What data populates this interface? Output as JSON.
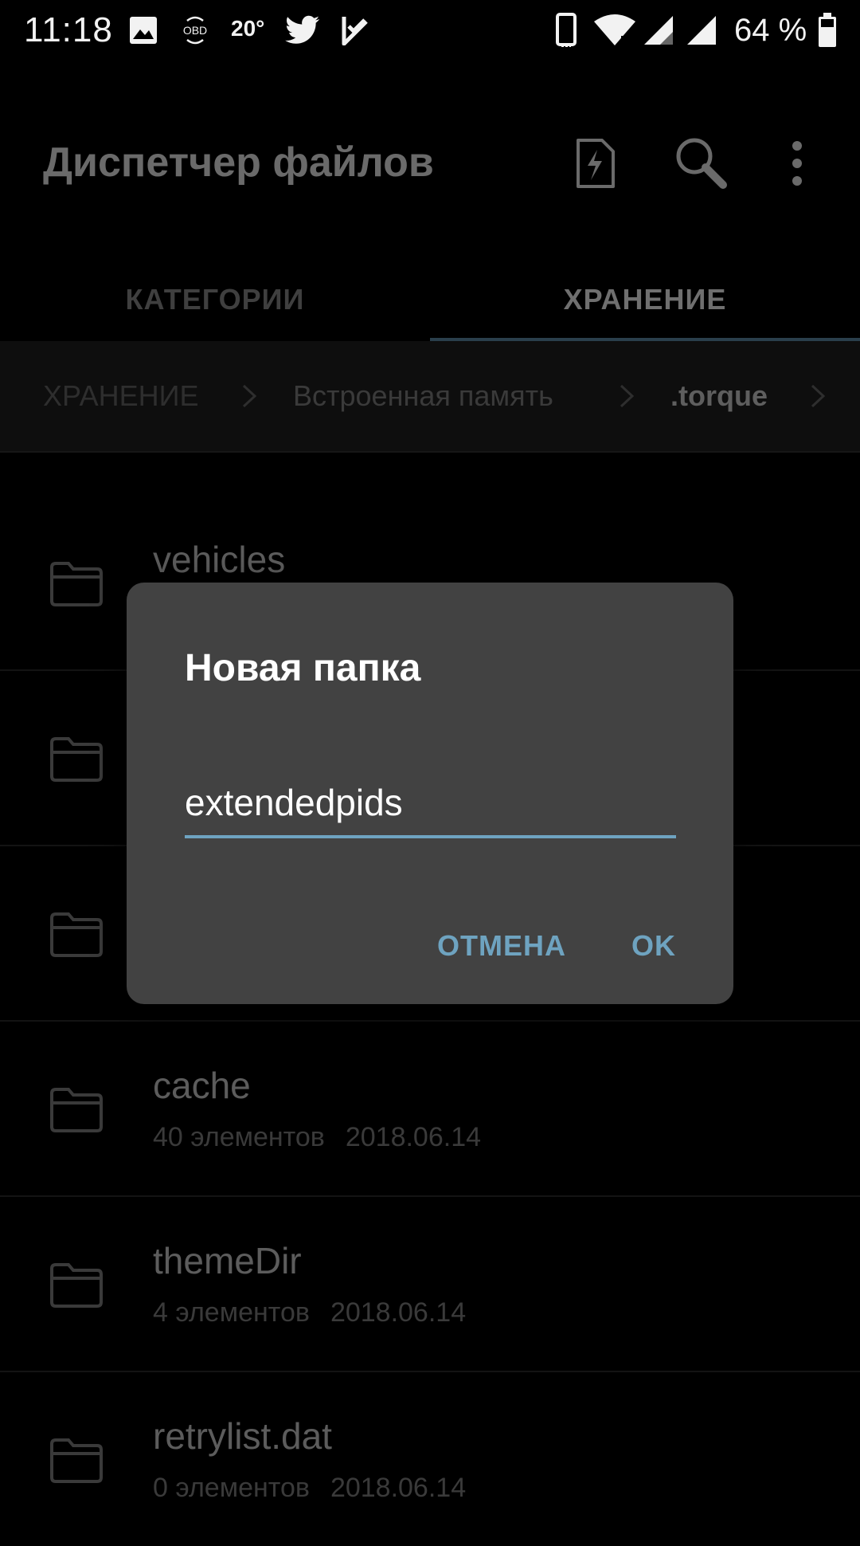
{
  "status_bar": {
    "time": "11:18",
    "temperature": "20°",
    "battery_percent": "64 %",
    "icons": [
      "gallery-icon",
      "obd-icon",
      "twitter-icon",
      "task-check-icon",
      "phone-vibrate-icon",
      "wifi-icon",
      "signal-icon",
      "signal-icon",
      "battery-icon"
    ]
  },
  "app_bar": {
    "title": "Диспетчер файлов",
    "actions": [
      "storage-clean-icon",
      "search-icon",
      "more-vert-icon"
    ]
  },
  "tabs": [
    {
      "label": "КАТЕГОРИИ",
      "selected": false
    },
    {
      "label": "ХРАНЕНИЕ",
      "selected": true
    }
  ],
  "breadcrumb": [
    {
      "label": "ХРАНЕНИЕ"
    },
    {
      "label": "Встроенная память"
    },
    {
      "label": ".torque"
    }
  ],
  "files": [
    {
      "name": "vehicles",
      "count": "",
      "date": ""
    },
    {
      "name": "",
      "count": "",
      "date": ""
    },
    {
      "name": "",
      "count": "",
      "date": ""
    },
    {
      "name": "cache",
      "count": "40 элементов",
      "date": "2018.06.14"
    },
    {
      "name": "themeDir",
      "count": "4 элементов",
      "date": "2018.06.14"
    },
    {
      "name": "retrylist.dat",
      "count": "0 элементов",
      "date": "2018.06.14"
    }
  ],
  "dialog": {
    "title": "Новая папка",
    "input_value": "extendedpids",
    "cancel_label": "ОТМЕНА",
    "ok_label": "OK"
  },
  "colors": {
    "background": "#000000",
    "dialog": "#424242",
    "accent": "#6ea3c0"
  }
}
